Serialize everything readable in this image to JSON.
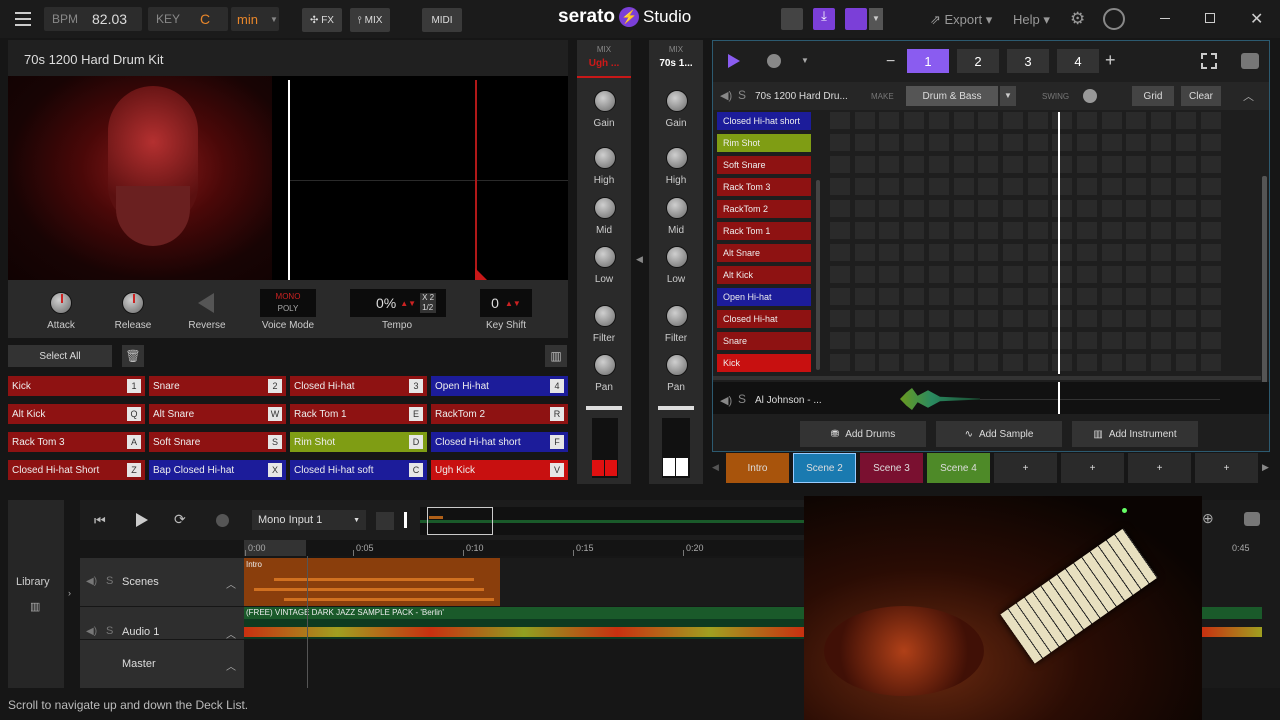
{
  "topbar": {
    "bpm_label": "BPM",
    "bpm": "82.03",
    "key_label": "KEY",
    "key": "C",
    "scale": "min",
    "fx": "FX",
    "mix": "MIX",
    "midi": "MIDI",
    "brand": "serato",
    "brand2": "Studio",
    "export": "Export",
    "help": "Help"
  },
  "deck": {
    "title": "70s 1200 Hard Drum Kit",
    "controls": [
      "Attack",
      "Release",
      "Reverse",
      "Voice Mode",
      "Tempo",
      "Key Shift"
    ],
    "mono": "MONO",
    "poly": "POLY",
    "tempo_val": "0%",
    "x2": "X 2",
    "half": "1/2",
    "keyshift_val": "0",
    "select_all": "Select All"
  },
  "pads": [
    {
      "label": "Kick",
      "key": "1",
      "color": "#8e1212"
    },
    {
      "label": "Snare",
      "key": "2",
      "color": "#8e1212"
    },
    {
      "label": "Closed Hi-hat",
      "key": "3",
      "color": "#8e1212"
    },
    {
      "label": "Open Hi-hat",
      "key": "4",
      "color": "#1c1c9a"
    },
    {
      "label": "Alt Kick",
      "key": "Q",
      "color": "#8e1212"
    },
    {
      "label": "Alt Snare",
      "key": "W",
      "color": "#8e1212"
    },
    {
      "label": "Rack Tom 1",
      "key": "E",
      "color": "#8e1212"
    },
    {
      "label": "RackTom 2",
      "key": "R",
      "color": "#8e1212"
    },
    {
      "label": "Rack Tom 3",
      "key": "A",
      "color": "#8e1212"
    },
    {
      "label": "Soft Snare",
      "key": "S",
      "color": "#8e1212"
    },
    {
      "label": "Rim Shot",
      "key": "D",
      "color": "#7f9d14"
    },
    {
      "label": "Closed Hi-hat short",
      "key": "F",
      "color": "#1c1c9a"
    },
    {
      "label": "Closed Hi-hat Short",
      "key": "Z",
      "color": "#8e1212"
    },
    {
      "label": "Bap Closed Hi-hat",
      "key": "X",
      "color": "#1c1c9a"
    },
    {
      "label": "Closed Hi-hat soft",
      "key": "C",
      "color": "#1c1c9a"
    },
    {
      "label": "Ugh Kick",
      "key": "V",
      "color": "#c81010"
    }
  ],
  "mixer": {
    "ch1": "MIX",
    "ch1_name": "Ugh ...",
    "ch2": "MIX",
    "ch2_name": "70s 1...",
    "knobs": [
      "Gain",
      "High",
      "Mid",
      "Low",
      "Filter",
      "Pan"
    ]
  },
  "sequencer": {
    "patterns": [
      "1",
      "2",
      "3",
      "4"
    ],
    "track": "70s 1200 Hard Dru...",
    "make": "MAKE",
    "genre": "Drum & Bass",
    "swing": "SWING",
    "grid": "Grid",
    "clear": "Clear",
    "rows": [
      {
        "label": "Closed Hi-hat short",
        "color": "#1c1c9a"
      },
      {
        "label": "Rim Shot",
        "color": "#7f9d14"
      },
      {
        "label": "Soft Snare",
        "color": "#8e1212"
      },
      {
        "label": "Rack Tom 3",
        "color": "#8e1212"
      },
      {
        "label": "RackTom 2",
        "color": "#8e1212"
      },
      {
        "label": "Rack Tom 1",
        "color": "#8e1212"
      },
      {
        "label": "Alt Snare",
        "color": "#8e1212"
      },
      {
        "label": "Alt Kick",
        "color": "#8e1212"
      },
      {
        "label": "Open Hi-hat",
        "color": "#1c1c9a"
      },
      {
        "label": "Closed Hi-hat",
        "color": "#8e1212"
      },
      {
        "label": "Snare",
        "color": "#8e1212"
      },
      {
        "label": "Kick",
        "color": "#c81010"
      }
    ],
    "sample_track": "Al Johnson - ...",
    "add_drums": "Add Drums",
    "add_sample": "Add Sample",
    "add_instrument": "Add Instrument"
  },
  "scenes": [
    {
      "label": "Intro",
      "color": "#a8540c"
    },
    {
      "label": "Scene 2",
      "color": "#1a7ab0"
    },
    {
      "label": "Scene 3",
      "color": "#7a1030"
    },
    {
      "label": "Scene 4",
      "color": "#4e8a28"
    },
    {
      "label": "+",
      "color": "#2a2a2a"
    },
    {
      "label": "+",
      "color": "#2a2a2a"
    },
    {
      "label": "+",
      "color": "#2a2a2a"
    },
    {
      "label": "+",
      "color": "#2a2a2a"
    }
  ],
  "arrange": {
    "library": "Library",
    "input": "Mono Input 1",
    "times": [
      "0:00",
      "0:05",
      "0:10",
      "0:15",
      "0:20",
      "0:45"
    ],
    "scenes": "Scenes",
    "audio": "Audio 1",
    "master": "Master",
    "intro": "Intro",
    "audio_clip": "(FREE) VINTAGE DARK JAZZ SAMPLE PACK - 'Berlin'"
  },
  "status": "Scroll to navigate up and down the Deck List."
}
